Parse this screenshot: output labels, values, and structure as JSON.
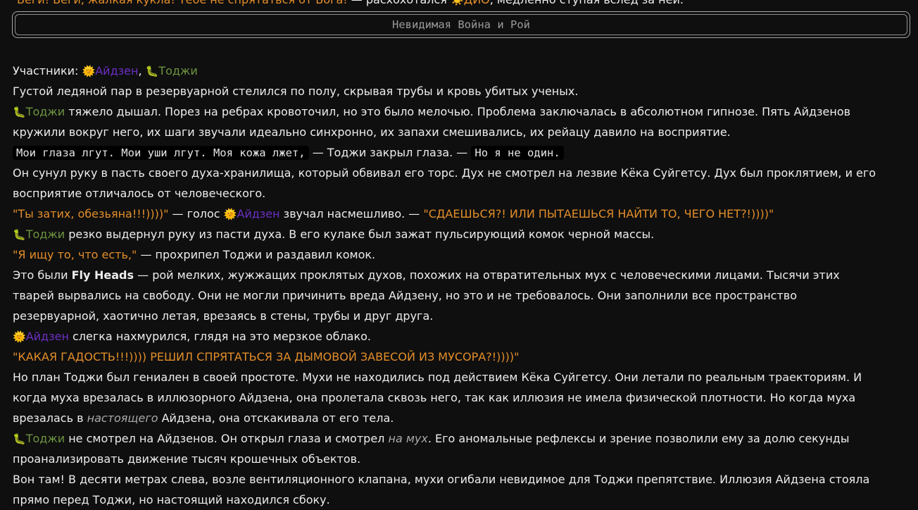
{
  "top_line": {
    "quote": "Беги! Беги, жалкая кукла! Тебе не спрятаться от Бога!",
    "tail_a": " — расхохотался ",
    "dio_icon": "☀️",
    "dio_name": "ДИО",
    "tail_b": ", медленно ступая вслед за ней."
  },
  "title_box": {
    "title": "Невидимая Война и Рой"
  },
  "names": {
    "aizen": "Айдзен",
    "toji": "Тоджи",
    "aizen_icon": "🌞",
    "toji_icon": "🐛"
  },
  "story": {
    "l1_label": "Участники: ",
    "l1_comma": ", ",
    "l2": "Густой ледяной пар в резервуарной стелился по полу, скрывая трубы и кровь убитых ученых.",
    "l3": " тяжело дышал. Порез на ребрах кровоточил, но это было мелочью. Проблема заключалась в абсолютном гипнозе. Пять Айдзенов",
    "l4": "кружили вокруг него, их шаги звучали идеально синхронно, их запахи смешивались, их рейацу давило на восприятие.",
    "l5_code1": "Мои глаза лгут. Мои уши лгут. Моя кожа лжет,",
    "l5_mid": " — Тоджи закрыл глаза. — ",
    "l5_code2": "Но я не один.",
    "l6": "Он сунул руку в пасть своего духа-хранилища, который обвивал его торс. Дух не смотрел на лезвие Кёка Суйгетсу. Дух был проклятием, и его",
    "l7": "восприятие отличалось от человеческого.",
    "l8_q1": "\"Ты затих, обезьяна!!!))))\"",
    "l8_mid": " — голос ",
    "l8_mid2": " звучал насмешливо. — ",
    "l8_q2": "\"СДАЕШЬСЯ?! ИЛИ ПЫТАЕШЬСЯ НАЙТИ ТО, ЧЕГО НЕТ?!))))\"",
    "l9": " резко выдернул руку из пасти духа. В его кулаке был зажат пульсирующий комок черной массы.",
    "l10_q": "\"Я ищу то, что есть,\"",
    "l10_rest": " — прохрипел Тоджи и раздавил комок.",
    "l11_a": "Это были ",
    "l11_bold": "Fly Heads",
    "l11_b": " — рой мелких, жужжащих проклятых духов, похожих на отвратительных мух с человеческими лицами. Тысячи этих",
    "l12": "тварей вырвались на свободу. Они не могли причинить вреда Айдзену, но это и не требовалось. Они заполнили все пространство",
    "l13": "резервуарной, хаотично летая, врезаясь в стены, трубы и друг друга.",
    "l14": " слегка нахмурился, глядя на это мерзкое облако.",
    "l15_q": "\"КАКАЯ ГАДОСТЬ!!!)))) РЕШИЛ СПРЯТАТЬСЯ ЗА ДЫМОВОЙ ЗАВЕСОЙ ИЗ МУСОРА?!))))\"",
    "l16": "Но план Тоджи был гениален в своей простоте. Мухи не находились под действием Кёка Суйгетсу. Они летали по реальным траекториям. И",
    "l17": "когда муха врезалась в иллюзорного Айдзена, она пролетала сквозь него, так как иллюзия не имела физической плотности. Но когда муха",
    "l18_a": "врезалась в ",
    "l18_em": "настоящего",
    "l18_b": " Айдзена, она отскакивала от его тела.",
    "l19_a": " не смотрел на Айдзенов. Он открыл глаза и смотрел ",
    "l19_em": "на мух",
    "l19_b": ". Его аномальные рефлексы и зрение позволили ему за долю секунды",
    "l20": "проанализировать движение тысяч крошечных объектов.",
    "l21": "Вон там! В десяти метрах слева, возле вентиляционного клапана, мухи огибали невидимое для Тоджи препятствие. Иллюзия Айдзена стояла",
    "l22": "прямо перед Тоджи, но настоящий находился сбоку."
  }
}
